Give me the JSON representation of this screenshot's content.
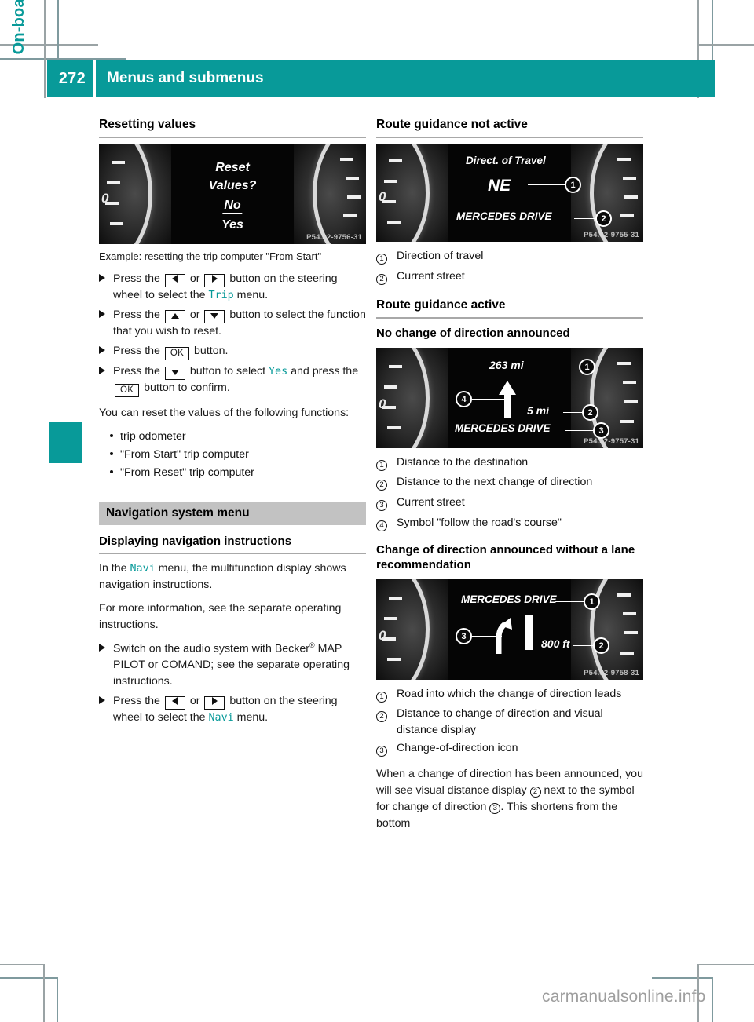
{
  "header": {
    "page_number": "272",
    "title": "Menus and submenus",
    "accent_color": "#089a99"
  },
  "running_title": "On-board computer and displays",
  "footer_watermark": "carmanualsonline.info",
  "left_column": {
    "section_heading": "Resetting values",
    "figure": {
      "lines": [
        "Reset",
        "Values?",
        "No",
        "Yes"
      ],
      "watermark": "P54.32-9756-31"
    },
    "caption": "Example: resetting the trip computer \"From Start\"",
    "steps": [
      {
        "parts": [
          {
            "t": "text",
            "v": "Press the "
          },
          {
            "t": "key",
            "v": "left"
          },
          {
            "t": "text",
            "v": " or "
          },
          {
            "t": "key",
            "v": "right"
          },
          {
            "t": "text",
            "v": " button on the steering wheel to select the "
          },
          {
            "t": "mono",
            "v": "Trip"
          },
          {
            "t": "text",
            "v": " menu."
          }
        ]
      },
      {
        "parts": [
          {
            "t": "text",
            "v": "Press the "
          },
          {
            "t": "key",
            "v": "up"
          },
          {
            "t": "text",
            "v": " or "
          },
          {
            "t": "key",
            "v": "down"
          },
          {
            "t": "text",
            "v": " button to select the function that you wish to reset."
          }
        ]
      },
      {
        "parts": [
          {
            "t": "text",
            "v": "Press the "
          },
          {
            "t": "key",
            "v": "OK"
          },
          {
            "t": "text",
            "v": " button."
          }
        ]
      },
      {
        "parts": [
          {
            "t": "text",
            "v": "Press the "
          },
          {
            "t": "key",
            "v": "down"
          },
          {
            "t": "text",
            "v": " button to select "
          },
          {
            "t": "mono",
            "v": "Yes"
          },
          {
            "t": "text",
            "v": " and press the "
          },
          {
            "t": "key",
            "v": "OK"
          },
          {
            "t": "text",
            "v": " button to confirm."
          }
        ]
      }
    ],
    "reset_intro": "You can reset the values of the following functions:",
    "reset_items": [
      "trip odometer",
      "\"From Start\" trip computer",
      "\"From Reset\" trip computer"
    ],
    "band_heading": "Navigation system menu",
    "sub_heading": "Displaying navigation instructions",
    "nav_para_1": {
      "parts": [
        {
          "t": "text",
          "v": "In the "
        },
        {
          "t": "mono",
          "v": "Navi"
        },
        {
          "t": "text",
          "v": " menu, the multifunction display shows navigation instructions."
        }
      ]
    },
    "nav_para_2": "For more information, see the separate operating instructions.",
    "nav_steps": [
      {
        "parts": [
          {
            "t": "text",
            "v": "Switch on the audio system with Becker"
          },
          {
            "t": "sup",
            "v": "®"
          },
          {
            "t": "text",
            "v": " MAP PILOT or COMAND; see the separate operating instructions."
          }
        ]
      },
      {
        "parts": [
          {
            "t": "text",
            "v": "Press the "
          },
          {
            "t": "key",
            "v": "left"
          },
          {
            "t": "text",
            "v": " or "
          },
          {
            "t": "key",
            "v": "right"
          },
          {
            "t": "text",
            "v": " button on the steering wheel to select the "
          },
          {
            "t": "mono",
            "v": "Navi"
          },
          {
            "t": "text",
            "v": " menu."
          }
        ]
      }
    ]
  },
  "right_column": {
    "heading_not_active": "Route guidance not active",
    "figure_not_active": {
      "title_line": "Direct. of Travel",
      "direction": "NE",
      "street": "MERCEDES DRIVE",
      "watermark": "P54.32-9755-31",
      "callouts": [
        "1",
        "2"
      ]
    },
    "legend_not_active": [
      {
        "num": "1",
        "text": "Direction of travel"
      },
      {
        "num": "2",
        "text": "Current street"
      }
    ],
    "heading_active": "Route guidance active",
    "sub_no_change": "No change of direction announced",
    "figure_no_change": {
      "distance_destination": "263 mi",
      "distance_next": "5 mi",
      "street": "MERCEDES DRIVE",
      "watermark": "P54.32-9757-31",
      "callouts": [
        "1",
        "2",
        "3",
        "4"
      ]
    },
    "legend_no_change": [
      {
        "num": "1",
        "text": "Distance to the destination"
      },
      {
        "num": "2",
        "text": "Distance to the next change of direction"
      },
      {
        "num": "3",
        "text": "Current street"
      },
      {
        "num": "4",
        "text": "Symbol \"follow the road's course\""
      }
    ],
    "sub_change": "Change of direction announced without a lane recommendation",
    "figure_change": {
      "street": "MERCEDES DRIVE",
      "distance": "800 ft",
      "watermark": "P54.32-9758-31",
      "callouts": [
        "1",
        "2",
        "3"
      ]
    },
    "legend_change": [
      {
        "num": "1",
        "text": "Road into which the change of direction leads"
      },
      {
        "num": "2",
        "text": "Distance to change of direction and visual distance display"
      },
      {
        "num": "3",
        "text": "Change-of-direction icon"
      }
    ],
    "closing_para": {
      "parts": [
        {
          "t": "text",
          "v": "When a change of direction has been announced, you will see visual distance display "
        },
        {
          "t": "num",
          "v": "2"
        },
        {
          "t": "text",
          "v": " next to the symbol for change of direction "
        },
        {
          "t": "num",
          "v": "3"
        },
        {
          "t": "text",
          "v": ". This shortens from the bottom"
        }
      ]
    }
  }
}
